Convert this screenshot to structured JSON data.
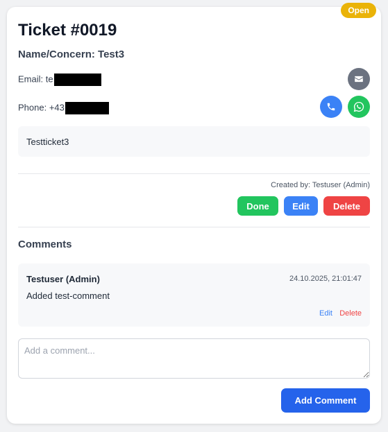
{
  "ticket": {
    "status": "Open",
    "title": "Ticket #0019",
    "concern": "Name/Concern: Test3",
    "email_label": "Email: te",
    "phone_label": "Phone: +43",
    "description": "Testticket3",
    "created_by": "Created by: Testuser (Admin)"
  },
  "contact_icons": [
    "mail-icon",
    "phone-icon",
    "whatsapp-icon"
  ],
  "actions": {
    "done": "Done",
    "edit": "Edit",
    "delete": "Delete"
  },
  "comments": {
    "heading": "Comments",
    "items": [
      {
        "author": "Testuser (Admin)",
        "timestamp": "24.10.2025, 21:01:47",
        "text": "Added test-comment",
        "edit": "Edit",
        "delete": "Delete"
      }
    ],
    "input_placeholder": "Add a comment...",
    "add_label": "Add Comment"
  },
  "colors": {
    "status": "#eab308",
    "done": "#22c55e",
    "edit": "#3b82f6",
    "delete": "#ef4444",
    "primary": "#2563eb"
  }
}
